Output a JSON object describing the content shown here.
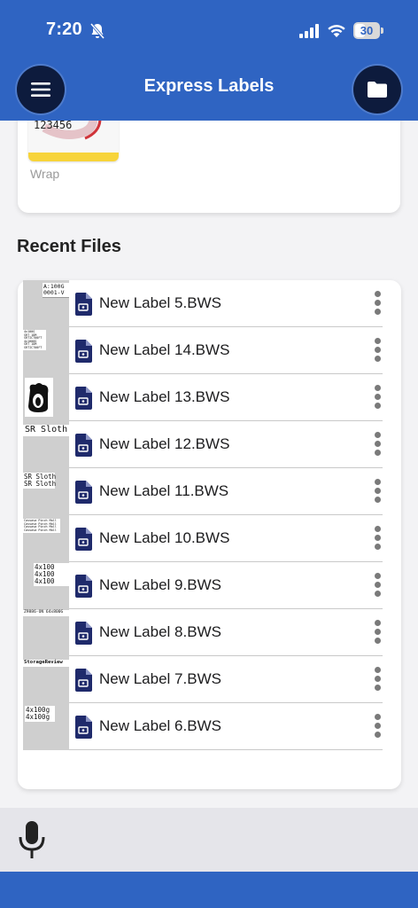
{
  "status_bar": {
    "time": "7:20",
    "battery_level": "30"
  },
  "header": {
    "title": "Express Labels"
  },
  "templates": {
    "items": [
      {
        "label": "Wrap",
        "thumb_text": "123456"
      }
    ]
  },
  "recent_files": {
    "title": "Recent Files",
    "items": [
      {
        "name": "New Label 5.BWS",
        "thumb_text": "A:100G\n0001-V"
      },
      {
        "name": "New Label 14.BWS",
        "thumb_text": "4x100G\nSRT 1DM\nSRTIC700FT\n4x1006G\nSRT 1DM\nSRTIC700FT"
      },
      {
        "name": "New Label 13.BWS",
        "thumb_text": ""
      },
      {
        "name": "New Label 12.BWS",
        "thumb_text": "SR Sloth"
      },
      {
        "name": "New Label 11.BWS",
        "thumb_text": "SR Sloth\nSR Sloth"
      },
      {
        "name": "New Label 10.BWS",
        "thumb_text": "Cassava Pinch Mall\nCassava Pinch Mall\nCassava Pinch Mall\nCassava Pinch Mall"
      },
      {
        "name": "New Label 9.BWS",
        "thumb_text": "4x100\n4x100\n4x100"
      },
      {
        "name": "New Label 8.BWS",
        "thumb_text": "Z9886-ON 64x800G"
      },
      {
        "name": "New Label 7.BWS",
        "thumb_text": "StorageReview"
      },
      {
        "name": "New Label 6.BWS",
        "thumb_text": "4x100g\n4x100g"
      }
    ]
  },
  "colors": {
    "brand_blue": "#2f64c2",
    "button_navy": "#0d1b3d",
    "file_icon": "#1f2a6b"
  },
  "icons": {
    "menu": "hamburger-icon",
    "folder": "folder-icon",
    "file": "file-document-icon",
    "more": "more-vertical-icon",
    "mic": "microphone-icon"
  }
}
